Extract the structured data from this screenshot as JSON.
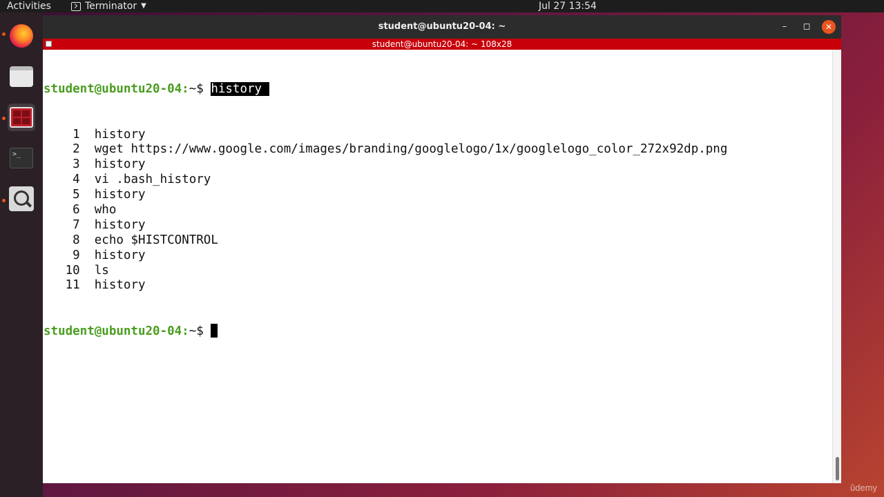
{
  "topbar": {
    "activities": "Activities",
    "app_name": "Terminator",
    "clock": "Jul 27  13:54"
  },
  "dock": {
    "items": [
      {
        "icon": "firefox-icon",
        "running": true
      },
      {
        "icon": "files-icon",
        "running": false
      },
      {
        "icon": "terminator-icon",
        "running": true,
        "active": true
      },
      {
        "icon": "terminal-icon",
        "running": false
      },
      {
        "icon": "screenshot-search-icon",
        "running": true
      }
    ]
  },
  "window": {
    "title": "student@ubuntu20-04: ~",
    "terminal_header": "student@ubuntu20-04: ~ 108x28",
    "minimize": "–",
    "maximize": "◻",
    "close": "✕"
  },
  "terminal": {
    "prompt": "student@ubuntu20-04:",
    "prompt_path": "~$ ",
    "command": "history ",
    "history": [
      {
        "num": "    1",
        "cmd": "  history"
      },
      {
        "num": "    2",
        "cmd": "  wget https://www.google.com/images/branding/googlelogo/1x/googlelogo_color_272x92dp.png"
      },
      {
        "num": "    3",
        "cmd": "  history"
      },
      {
        "num": "    4",
        "cmd": "  vi .bash_history"
      },
      {
        "num": "    5",
        "cmd": "  history"
      },
      {
        "num": "    6",
        "cmd": "  who"
      },
      {
        "num": "    7",
        "cmd": "  history"
      },
      {
        "num": "    8",
        "cmd": "  echo $HISTCONTROL"
      },
      {
        "num": "    9",
        "cmd": "  history"
      },
      {
        "num": "   10",
        "cmd": "  ls"
      },
      {
        "num": "   11",
        "cmd": "  history"
      }
    ]
  },
  "watermark": "ûdemy",
  "colors": {
    "prompt": "#4a9d1f",
    "terminal_header": "#c7000a",
    "accent": "#e95420"
  }
}
